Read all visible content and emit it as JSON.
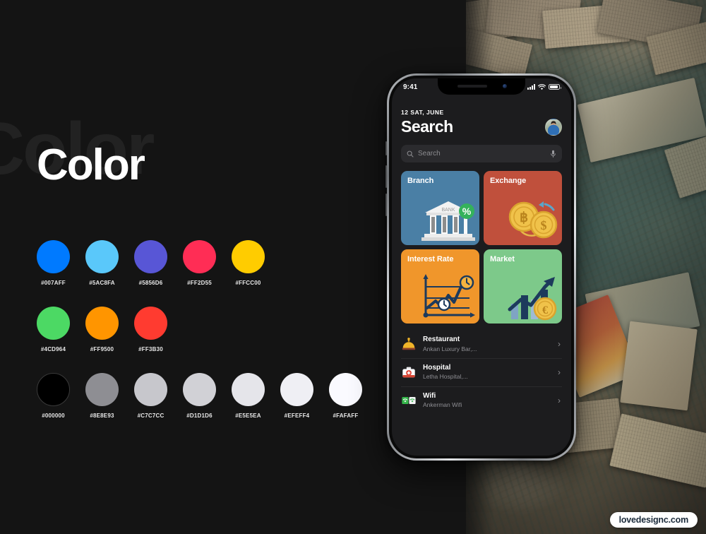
{
  "page": {
    "title": "Color",
    "ghost_title": "Color",
    "watermark": "lovedesignc.com",
    "background_desc": "banknotes-on-world-map-photo"
  },
  "palette": {
    "rows": [
      [
        {
          "hex": "#007AFF",
          "label": "#007AFF"
        },
        {
          "hex": "#5AC8FA",
          "label": "#5AC8FA"
        },
        {
          "hex": "#5856D6",
          "label": "#5856D6"
        },
        {
          "hex": "#FF2D55",
          "label": "#FF2D55"
        },
        {
          "hex": "#FFCC00",
          "label": "#FFCC00"
        }
      ],
      [
        {
          "hex": "#4CD964",
          "label": "#4CD964"
        },
        {
          "hex": "#FF9500",
          "label": "#FF9500"
        },
        {
          "hex": "#FF3B30",
          "label": "#FF3B30"
        }
      ],
      [
        {
          "hex": "#000000",
          "label": "#000000"
        },
        {
          "hex": "#8E8E93",
          "label": "#8E8E93"
        },
        {
          "hex": "#C7C7CC",
          "label": "#C7C7CC"
        },
        {
          "hex": "#D1D1D6",
          "label": "#D1D1D6"
        },
        {
          "hex": "#E5E5EA",
          "label": "#E5E5EA"
        },
        {
          "hex": "#EFEFF4",
          "label": "#EFEFF4"
        },
        {
          "hex": "#FAFAFF",
          "label": "#FAFAFF"
        }
      ]
    ]
  },
  "phone": {
    "status_bar": {
      "time": "9:41",
      "signal_icon": "cellular-signal-icon",
      "wifi_icon": "wifi-icon",
      "battery_icon": "battery-icon"
    },
    "header": {
      "date": "12 SAT, JUNE",
      "title": "Search",
      "avatar": "user-avatar"
    },
    "search": {
      "placeholder": "Search",
      "search_icon": "search-icon",
      "mic_icon": "microphone-icon"
    },
    "cards": [
      {
        "label": "Branch",
        "bg": "#4A7FA5",
        "art": "bank-building-icon"
      },
      {
        "label": "Exchange",
        "bg": "#C0503C",
        "art": "currency-coins-icon"
      },
      {
        "label": "Interest Rate",
        "bg": "#F0962B",
        "art": "line-chart-icon"
      },
      {
        "label": "Market",
        "bg": "#7DC98A",
        "art": "bar-chart-euro-icon"
      }
    ],
    "list": [
      {
        "title": "Restaurant",
        "subtitle": "Ankan Luxury Bar,...",
        "icon": "restaurant-bell-icon",
        "chevron": "›"
      },
      {
        "title": "Hospital",
        "subtitle": "Letha Hospital,...",
        "icon": "medical-kit-icon",
        "chevron": "›"
      },
      {
        "title": "Wifi",
        "subtitle": "Ankerman Wifi",
        "icon": "wifi-tile-icon",
        "chevron": "›"
      }
    ]
  }
}
